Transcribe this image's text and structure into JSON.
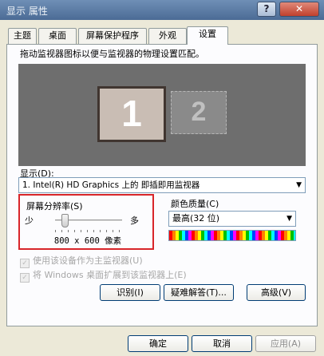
{
  "window": {
    "title": "显示 属性",
    "help_label": "?",
    "close_label": "✕"
  },
  "tabs": [
    {
      "label": "主题"
    },
    {
      "label": "桌面"
    },
    {
      "label": "屏幕保护程序"
    },
    {
      "label": "外观"
    },
    {
      "label": "设置"
    }
  ],
  "settings": {
    "intro": "拖动监视器图标以便与监视器的物理设置匹配。",
    "monitors": [
      {
        "number": "1"
      },
      {
        "number": "2"
      }
    ],
    "display_label": "显示(D):",
    "display_value": "1. Intel(R) HD Graphics 上的 即插即用监视器",
    "resolution": {
      "label": "屏幕分辨率(S)",
      "low": "少",
      "high": "多",
      "value": "800 x 600 像素",
      "slider_level": 0.1
    },
    "color_quality": {
      "label": "颜色质量(C)",
      "value": "最高(32 位)"
    },
    "checkboxes": [
      {
        "label": "使用该设备作为主监视器(U)",
        "checked": true
      },
      {
        "label": "将 Windows 桌面扩展到该监视器上(E)",
        "checked": true
      }
    ],
    "buttons": {
      "identify": "识别(I)",
      "troubleshoot": "疑难解答(T)...",
      "advanced": "高级(V)"
    }
  },
  "footer": {
    "ok": "确定",
    "cancel": "取消",
    "apply": "应用(A)"
  },
  "colors": {
    "highlight_box": "#d8252a",
    "monitor_area": "#6e6e6e"
  }
}
